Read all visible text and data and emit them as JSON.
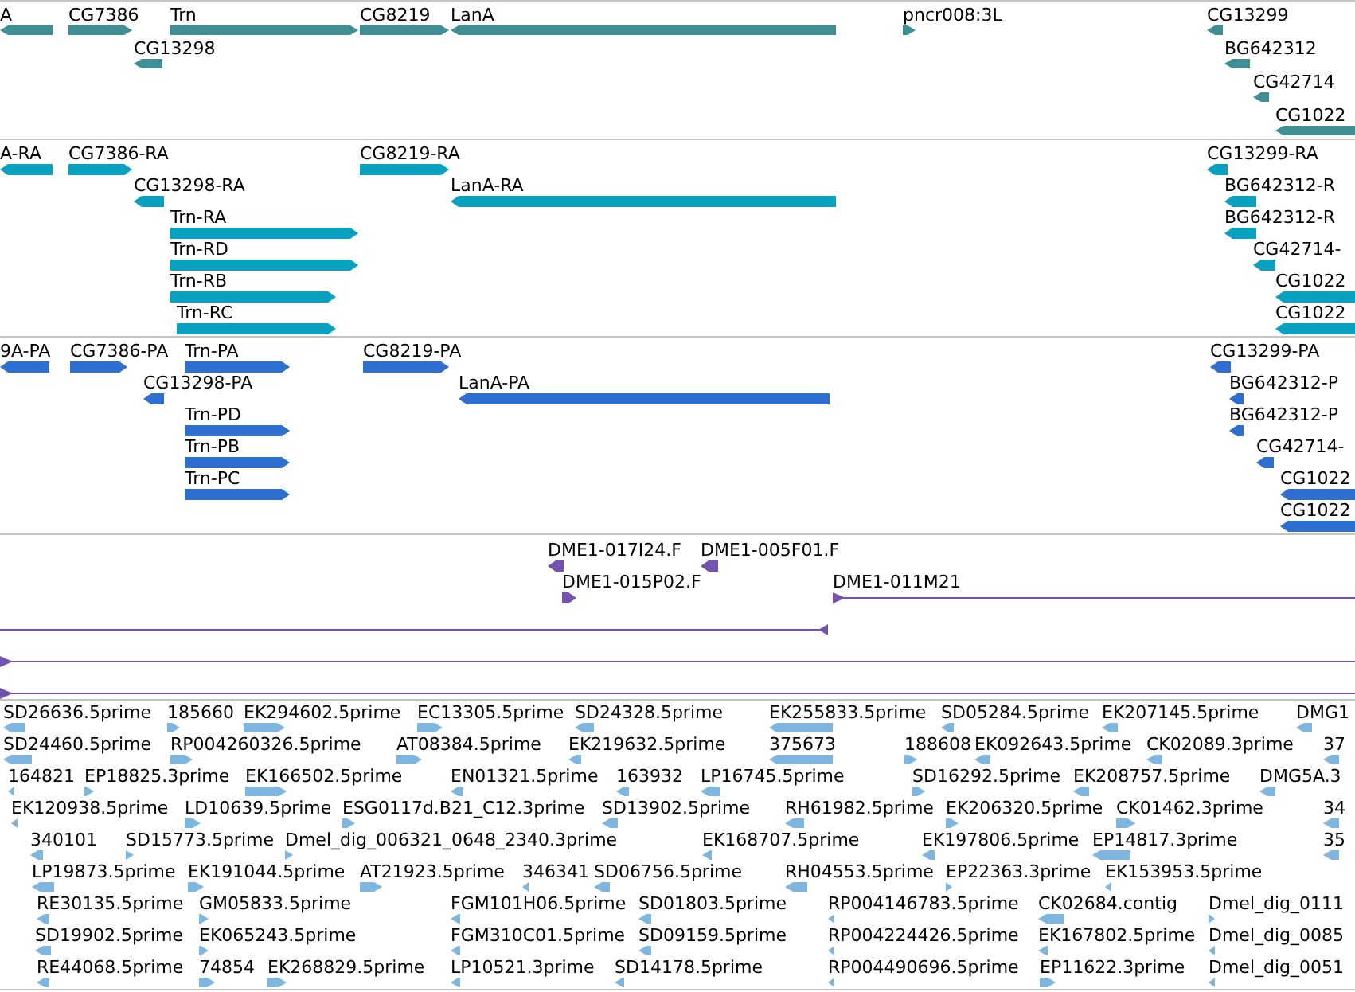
{
  "tracks": [
    {
      "color": "#3f8f94",
      "features": [
        {
          "label": "A",
          "reverse": true
        },
        {
          "label": "CG7386",
          "reverse": false
        },
        {
          "label": "Trn",
          "reverse": false
        },
        {
          "label": "CG8219",
          "reverse": false
        },
        {
          "label": "LanA",
          "reverse": true
        },
        {
          "label": "pncr008:3L",
          "reverse": false
        },
        {
          "label": "CG13299",
          "reverse": true
        },
        {
          "label": "CG13298",
          "reverse": true
        },
        {
          "label": "BG642312",
          "reverse": true
        },
        {
          "label": "CG42714",
          "reverse": true
        },
        {
          "label": "CG1022",
          "reverse": true
        }
      ]
    },
    {
      "color": "#0aa0c0",
      "features": [
        {
          "label": "A-RA",
          "reverse": true
        },
        {
          "label": "CG7386-RA",
          "reverse": false
        },
        {
          "label": "CG8219-RA",
          "reverse": false
        },
        {
          "label": "CG13299-RA",
          "reverse": true
        },
        {
          "label": "CG13298-RA",
          "reverse": true
        },
        {
          "label": "LanA-RA",
          "reverse": true
        },
        {
          "label": "BG642312-R",
          "reverse": true
        },
        {
          "label": "Trn-RA",
          "reverse": false
        },
        {
          "label": "BG642312-R",
          "reverse": true
        },
        {
          "label": "Trn-RD",
          "reverse": false
        },
        {
          "label": "CG42714-",
          "reverse": true
        },
        {
          "label": "Trn-RB",
          "reverse": false
        },
        {
          "label": "CG1022",
          "reverse": true
        },
        {
          "label": "Trn-RC",
          "reverse": false
        },
        {
          "label": "CG1022",
          "reverse": true
        }
      ]
    },
    {
      "color": "#2f6fd0",
      "features": [
        {
          "label": "9A-PA",
          "reverse": true
        },
        {
          "label": "CG7386-PA",
          "reverse": false
        },
        {
          "label": "Trn-PA",
          "reverse": false
        },
        {
          "label": "CG8219-PA",
          "reverse": false
        },
        {
          "label": "CG13299-PA",
          "reverse": true
        },
        {
          "label": "CG13298-PA",
          "reverse": true
        },
        {
          "label": "LanA-PA",
          "reverse": true
        },
        {
          "label": "BG642312-P",
          "reverse": true
        },
        {
          "label": "Trn-PD",
          "reverse": false
        },
        {
          "label": "BG642312-P",
          "reverse": true
        },
        {
          "label": "Trn-PB",
          "reverse": false
        },
        {
          "label": "CG42714-",
          "reverse": true
        },
        {
          "label": "Trn-PC",
          "reverse": false
        },
        {
          "label": "CG1022",
          "reverse": true
        },
        {
          "label": "CG1022",
          "reverse": true
        }
      ]
    },
    {
      "color": "#7353ad",
      "features": [
        {
          "label": "DME1-017I24.F",
          "reverse": true,
          "kind": "block"
        },
        {
          "label": "DME1-005F01.F",
          "reverse": true,
          "kind": "block"
        },
        {
          "label": "DME1-015P02.F",
          "reverse": false,
          "kind": "block"
        },
        {
          "label": "DME1-011M21",
          "reverse": false,
          "kind": "line"
        },
        {
          "reverse": true,
          "kind": "line"
        },
        {
          "reverse": false,
          "kind": "line"
        },
        {
          "reverse": false,
          "kind": "line"
        }
      ]
    },
    {
      "color": "#7fb6df",
      "features": [
        {
          "label": "SD26636.5prime",
          "reverse": true
        },
        {
          "label": "185660",
          "reverse": false
        },
        {
          "label": "EK294602.5prime",
          "reverse": false
        },
        {
          "label": "EC13305.5prime",
          "reverse": false
        },
        {
          "label": "SD24328.5prime",
          "reverse": true
        },
        {
          "label": "EK255833.5prime",
          "reverse": true
        },
        {
          "label": "SD05284.5prime",
          "reverse": true
        },
        {
          "label": "EK207145.5prime",
          "reverse": true
        },
        {
          "label": "DMG1",
          "reverse": true
        },
        {
          "label": "SD24460.5prime",
          "reverse": true
        },
        {
          "label": "RP004260326.5prime",
          "reverse": false
        },
        {
          "label": "AT08384.5prime",
          "reverse": false
        },
        {
          "label": "EK219632.5prime",
          "reverse": true
        },
        {
          "label": "375673",
          "reverse": true
        },
        {
          "label": "188608",
          "reverse": false
        },
        {
          "label": "EK092643.5prime",
          "reverse": true
        },
        {
          "label": "CK02089.3prime",
          "reverse": true
        },
        {
          "label": "37",
          "reverse": true
        },
        {
          "label": "164821",
          "reverse": true
        },
        {
          "label": "EP18825.3prime",
          "reverse": false
        },
        {
          "label": "EK166502.5prime",
          "reverse": false
        },
        {
          "label": "EN01321.5prime",
          "reverse": true
        },
        {
          "label": "163932",
          "reverse": true
        },
        {
          "label": "LP16745.5prime",
          "reverse": true
        },
        {
          "label": "SD16292.5prime",
          "reverse": false
        },
        {
          "label": "EK208757.5prime",
          "reverse": true
        },
        {
          "label": "DMG5A.3",
          "reverse": true
        },
        {
          "label": "EK120938.5prime",
          "reverse": true
        },
        {
          "label": "LD10639.5prime",
          "reverse": false
        },
        {
          "label": "ESG0117d.B21_C12.3prime",
          "reverse": false
        },
        {
          "label": "SD13902.5prime",
          "reverse": true
        },
        {
          "label": "RH61982.5prime",
          "reverse": true
        },
        {
          "label": "EK206320.5prime",
          "reverse": false
        },
        {
          "label": "CK01462.3prime",
          "reverse": false
        },
        {
          "label": "34",
          "reverse": true
        },
        {
          "label": "340101",
          "reverse": true
        },
        {
          "label": "SD15773.5prime",
          "reverse": false
        },
        {
          "label": "Dmel_dig_006321_0648_2340.3prime",
          "reverse": false
        },
        {
          "label": "EK168707.5prime",
          "reverse": true
        },
        {
          "label": "EK197806.5prime",
          "reverse": true
        },
        {
          "label": "EP14817.3prime",
          "reverse": true
        },
        {
          "label": "35",
          "reverse": true
        },
        {
          "label": "LP19873.5prime",
          "reverse": true
        },
        {
          "label": "EK191044.5prime",
          "reverse": false
        },
        {
          "label": "AT21923.5prime",
          "reverse": false
        },
        {
          "label": "346341",
          "reverse": true
        },
        {
          "label": "SD06756.5prime",
          "reverse": true
        },
        {
          "label": "RH04553.5prime",
          "reverse": true
        },
        {
          "label": "EP22363.3prime",
          "reverse": false
        },
        {
          "label": "EK153953.5prime",
          "reverse": true
        },
        {
          "label": "RE30135.5prime",
          "reverse": true
        },
        {
          "label": "GM05833.5prime",
          "reverse": false
        },
        {
          "label": "FGM101H06.5prime",
          "reverse": true
        },
        {
          "label": "SD01803.5prime",
          "reverse": true
        },
        {
          "label": "RP004146783.5prime",
          "reverse": true
        },
        {
          "label": "CK02684.contig",
          "reverse": true
        },
        {
          "label": "Dmel_dig_0111",
          "reverse": false
        },
        {
          "label": "SD19902.5prime",
          "reverse": true
        },
        {
          "label": "EK065243.5prime",
          "reverse": false
        },
        {
          "label": "FGM310C01.5prime",
          "reverse": true
        },
        {
          "label": "SD09159.5prime",
          "reverse": true
        },
        {
          "label": "RP004224426.5prime",
          "reverse": true
        },
        {
          "label": "EK167802.5prime",
          "reverse": true
        },
        {
          "label": "Dmel_dig_0085",
          "reverse": true
        },
        {
          "label": "RE44068.5prime",
          "reverse": true
        },
        {
          "label": "74854",
          "reverse": false
        },
        {
          "label": "EK268829.5prime",
          "reverse": false
        },
        {
          "label": "LP10521.3prime",
          "reverse": true
        },
        {
          "label": "SD14178.5prime",
          "reverse": true
        },
        {
          "label": "RP004490696.5prime",
          "reverse": true
        },
        {
          "label": "EP11622.3prime",
          "reverse": false
        },
        {
          "label": "Dmel_dig_0051",
          "reverse": true
        }
      ]
    }
  ]
}
